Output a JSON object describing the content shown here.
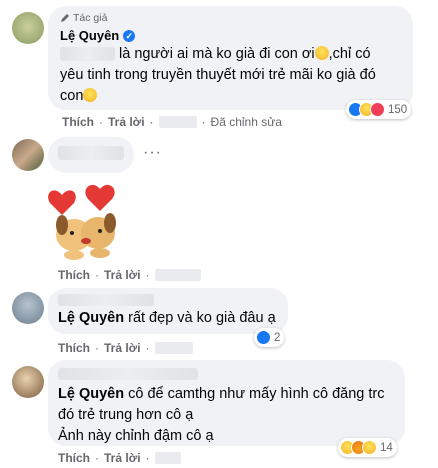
{
  "comments": [
    {
      "badge": "Tác giả",
      "name": "Lệ Quyên",
      "text_line1": "là người ai mà ko già đi con ơi",
      "text_line1_tail": ",chỉ có",
      "text_line2": "yêu tinh trong truyền thuyết mới trẻ mãi ko già đó",
      "text_line3": "con",
      "like": "Thích",
      "reply": "Trả lời",
      "edited": "Đã chỉnh sửa",
      "reaction_count": "150"
    },
    {
      "like": "Thích",
      "reply": "Trả lời"
    },
    {
      "mention": "Lệ Quyên",
      "text": "rất đẹp và ko già đâu ạ",
      "like": "Thích",
      "reply": "Trả lời",
      "reaction_count": "2"
    },
    {
      "mention": "Lệ Quyên",
      "text_line1": "cô để camthg như mấy hình cô đăng trc",
      "text_line2": "đó trẻ trung hơn cô ạ",
      "text_line3": "Ảnh này chỉnh đậm cô ạ",
      "like": "Thích",
      "reply": "Trả lời",
      "reaction_count": "14"
    }
  ],
  "colors": {
    "mention": "#050505",
    "action": "#65676b",
    "bubble": "#f0f2f5",
    "verified": "#1877f2"
  }
}
